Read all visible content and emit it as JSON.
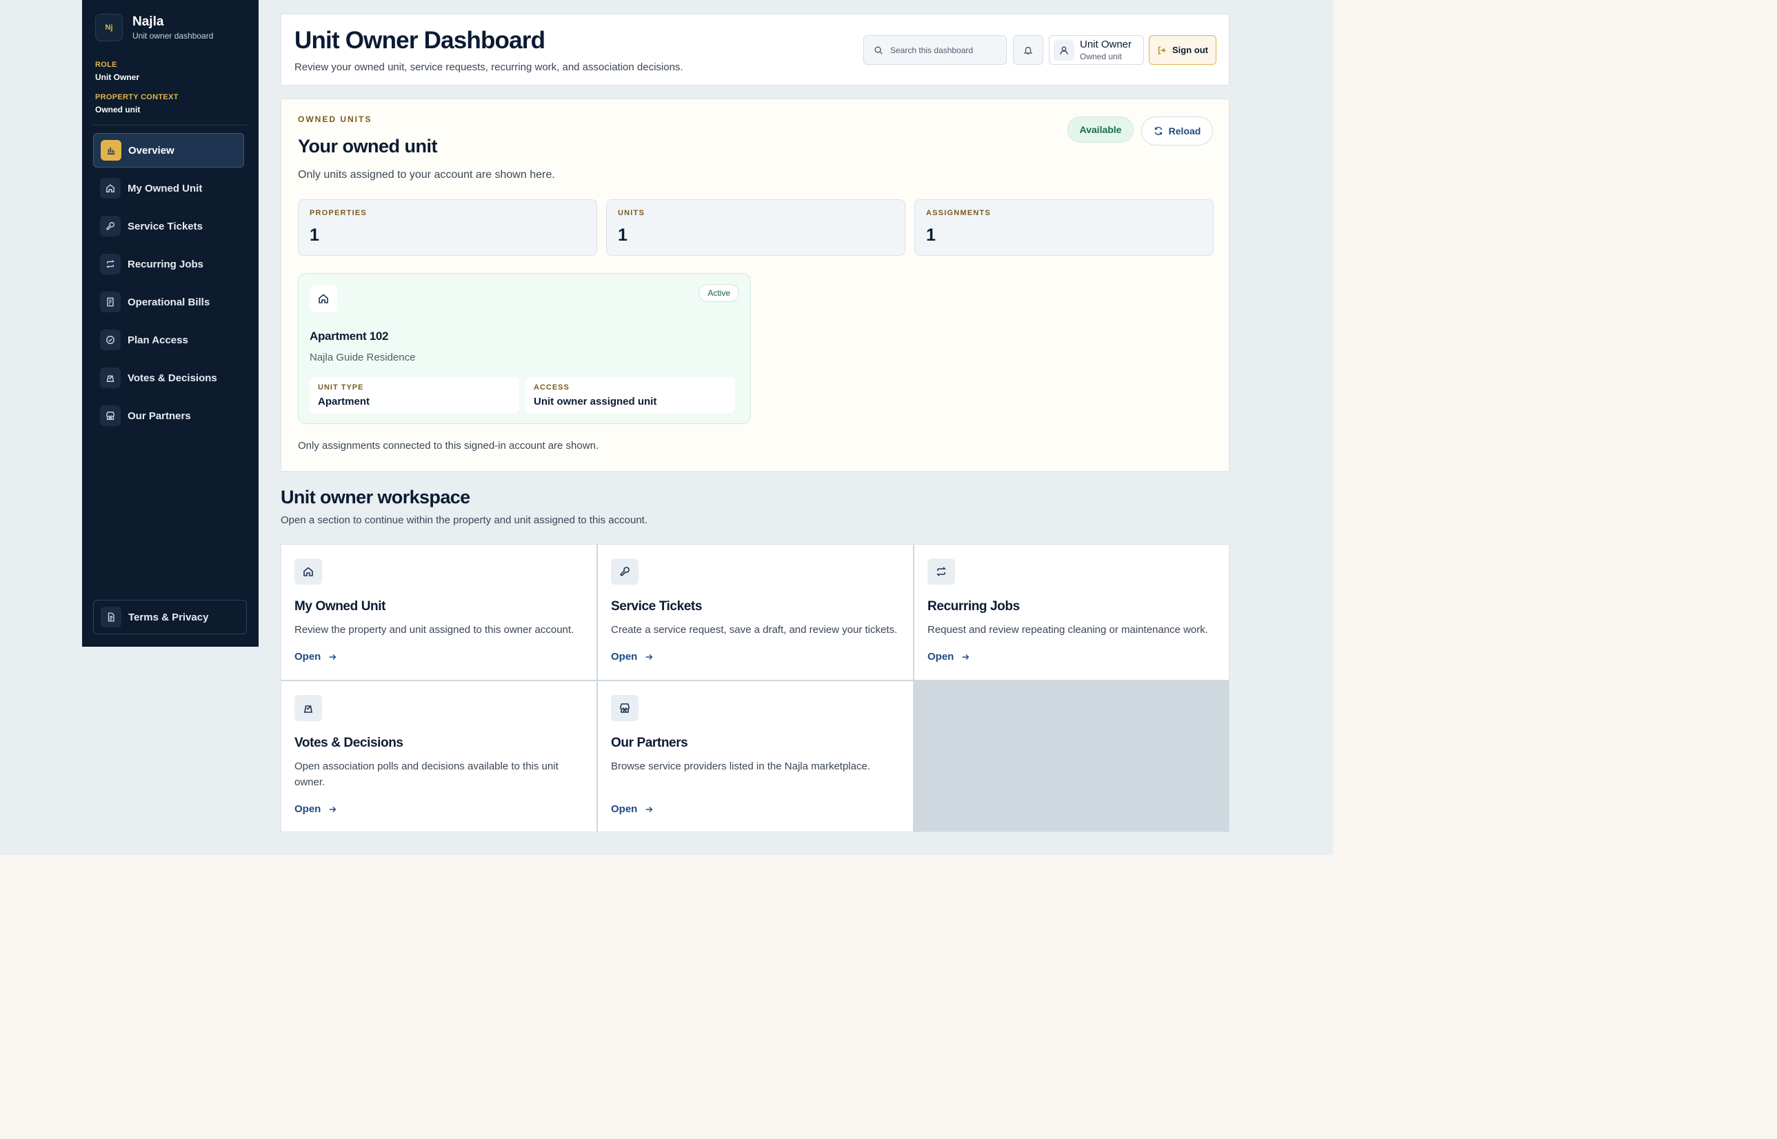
{
  "brand": {
    "name": "Najla",
    "subtitle": "Unit owner dashboard",
    "logo_text": "Nj"
  },
  "context": {
    "role_label": "ROLE",
    "role_value": "Unit Owner",
    "property_label": "PROPERTY CONTEXT",
    "property_value": "Owned unit"
  },
  "sidebar": {
    "items": [
      {
        "label": "Overview",
        "icon": "chart-icon",
        "active": true
      },
      {
        "label": "My Owned Unit",
        "icon": "home-icon"
      },
      {
        "label": "Service Tickets",
        "icon": "wrench-icon"
      },
      {
        "label": "Recurring Jobs",
        "icon": "repeat-icon"
      },
      {
        "label": "Operational Bills",
        "icon": "receipt-icon"
      },
      {
        "label": "Plan Access",
        "icon": "check-circle-icon"
      },
      {
        "label": "Votes & Decisions",
        "icon": "ballot-icon"
      },
      {
        "label": "Our Partners",
        "icon": "store-icon"
      }
    ],
    "footer_label": "Terms & Privacy"
  },
  "header": {
    "title": "Unit Owner Dashboard",
    "subtitle": "Review your owned unit, service requests, recurring work, and association decisions.",
    "search_placeholder": "Search this dashboard",
    "user_name": "Unit Owner",
    "user_context": "Owned unit",
    "signout_label": "Sign out"
  },
  "owned_units": {
    "eyebrow": "OWNED UNITS",
    "title": "Your owned unit",
    "subtitle": "Only units assigned to your account are shown here.",
    "status": "Available",
    "reload_label": "Reload",
    "stats": [
      {
        "label": "PROPERTIES",
        "value": "1"
      },
      {
        "label": "UNITS",
        "value": "1"
      },
      {
        "label": "ASSIGNMENTS",
        "value": "1"
      }
    ],
    "unit": {
      "badge": "Active",
      "name": "Apartment 102",
      "property": "Najla Guide Residence",
      "type_label": "UNIT TYPE",
      "type_value": "Apartment",
      "access_label": "ACCESS",
      "access_value": "Unit owner assigned unit"
    },
    "footnote": "Only assignments connected to this signed-in account are shown."
  },
  "workspace": {
    "title": "Unit owner workspace",
    "subtitle": "Open a section to continue within the property and unit assigned to this account.",
    "open_label": "Open",
    "tiles": [
      {
        "title": "My Owned Unit",
        "desc": "Review the property and unit assigned to this owner account.",
        "icon": "home-icon"
      },
      {
        "title": "Service Tickets",
        "desc": "Create a service request, save a draft, and review your tickets.",
        "icon": "wrench-icon"
      },
      {
        "title": "Recurring Jobs",
        "desc": "Request and review repeating cleaning or maintenance work.",
        "icon": "repeat-icon"
      },
      {
        "title": "Votes & Decisions",
        "desc": "Open association polls and decisions available to this unit owner.",
        "icon": "ballot-icon"
      },
      {
        "title": "Our Partners",
        "desc": "Browse service providers listed in the Najla marketplace.",
        "icon": "store-icon"
      }
    ]
  },
  "colors": {
    "sidebar": "#0c1b2e",
    "accent": "#e2b34d",
    "link": "#1f4a82",
    "success": "#1e6b4c"
  }
}
